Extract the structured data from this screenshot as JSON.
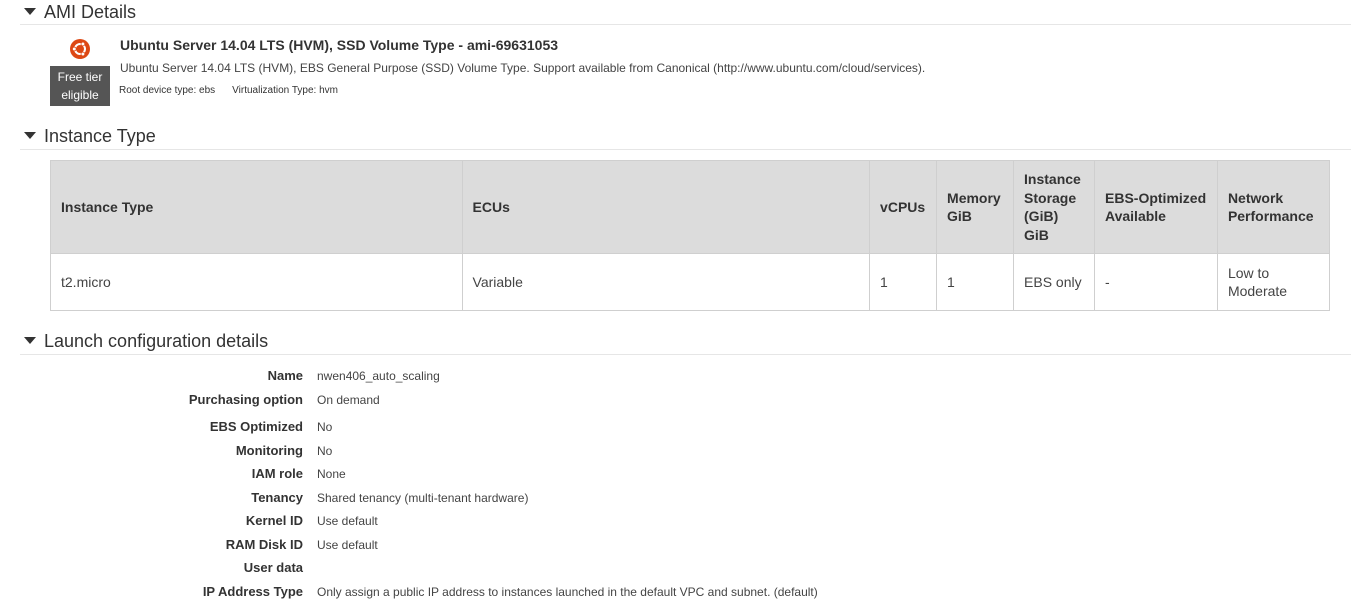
{
  "sections": {
    "ami": {
      "title": "AMI Details"
    },
    "instance_type": {
      "title": "Instance Type"
    },
    "launch_config": {
      "title": "Launch configuration details"
    }
  },
  "ami": {
    "icon": "ubuntu-logo-icon",
    "icon_color": "#dd4814",
    "free_tier_line1": "Free tier",
    "free_tier_line2": "eligible",
    "title": "Ubuntu Server 14.04 LTS (HVM), SSD Volume Type - ami-69631053",
    "description": "Ubuntu Server 14.04 LTS (HVM), EBS General Purpose (SSD) Volume Type. Support available from Canonical (http://www.ubuntu.com/cloud/services).",
    "root_device": "Root device type: ebs",
    "virtualization": "Virtualization Type: hvm"
  },
  "instance_table": {
    "headers": [
      "Instance Type",
      "ECUs",
      "vCPUs",
      "Memory GiB",
      "Instance Storage (GiB) GiB",
      "EBS-Optimized Available",
      "Network Performance"
    ],
    "header_lines": [
      [
        "Instance Type"
      ],
      [
        "ECUs"
      ],
      [
        "vCPUs"
      ],
      [
        "Memory",
        "GiB"
      ],
      [
        "Instance",
        "Storage",
        "(GiB)",
        "GiB"
      ],
      [
        "EBS-Optimized",
        "Available"
      ],
      [
        "Network",
        "Performance"
      ]
    ],
    "rows": [
      {
        "instance_type": "t2.micro",
        "ecus": "Variable",
        "vcpus": "1",
        "memory": "1",
        "storage": "EBS only",
        "ebs_optimized": "-",
        "network_line1": "Low to",
        "network_line2": "Moderate"
      }
    ]
  },
  "launch_config": {
    "rows": [
      {
        "label": "Name",
        "value": "nwen406_auto_scaling"
      },
      {
        "label": "Purchasing option",
        "value": "On demand"
      },
      {
        "label": "EBS Optimized",
        "value": "No"
      },
      {
        "label": "Monitoring",
        "value": "No"
      },
      {
        "label": "IAM role",
        "value": "None"
      },
      {
        "label": "Tenancy",
        "value": "Shared tenancy (multi-tenant hardware)"
      },
      {
        "label": "Kernel ID",
        "value": "Use default"
      },
      {
        "label": "RAM Disk ID",
        "value": "Use default"
      },
      {
        "label": "User data",
        "value": ""
      },
      {
        "label": "IP Address Type",
        "value": "Only assign a public IP address to instances launched in the default VPC and subnet. (default)"
      }
    ]
  }
}
